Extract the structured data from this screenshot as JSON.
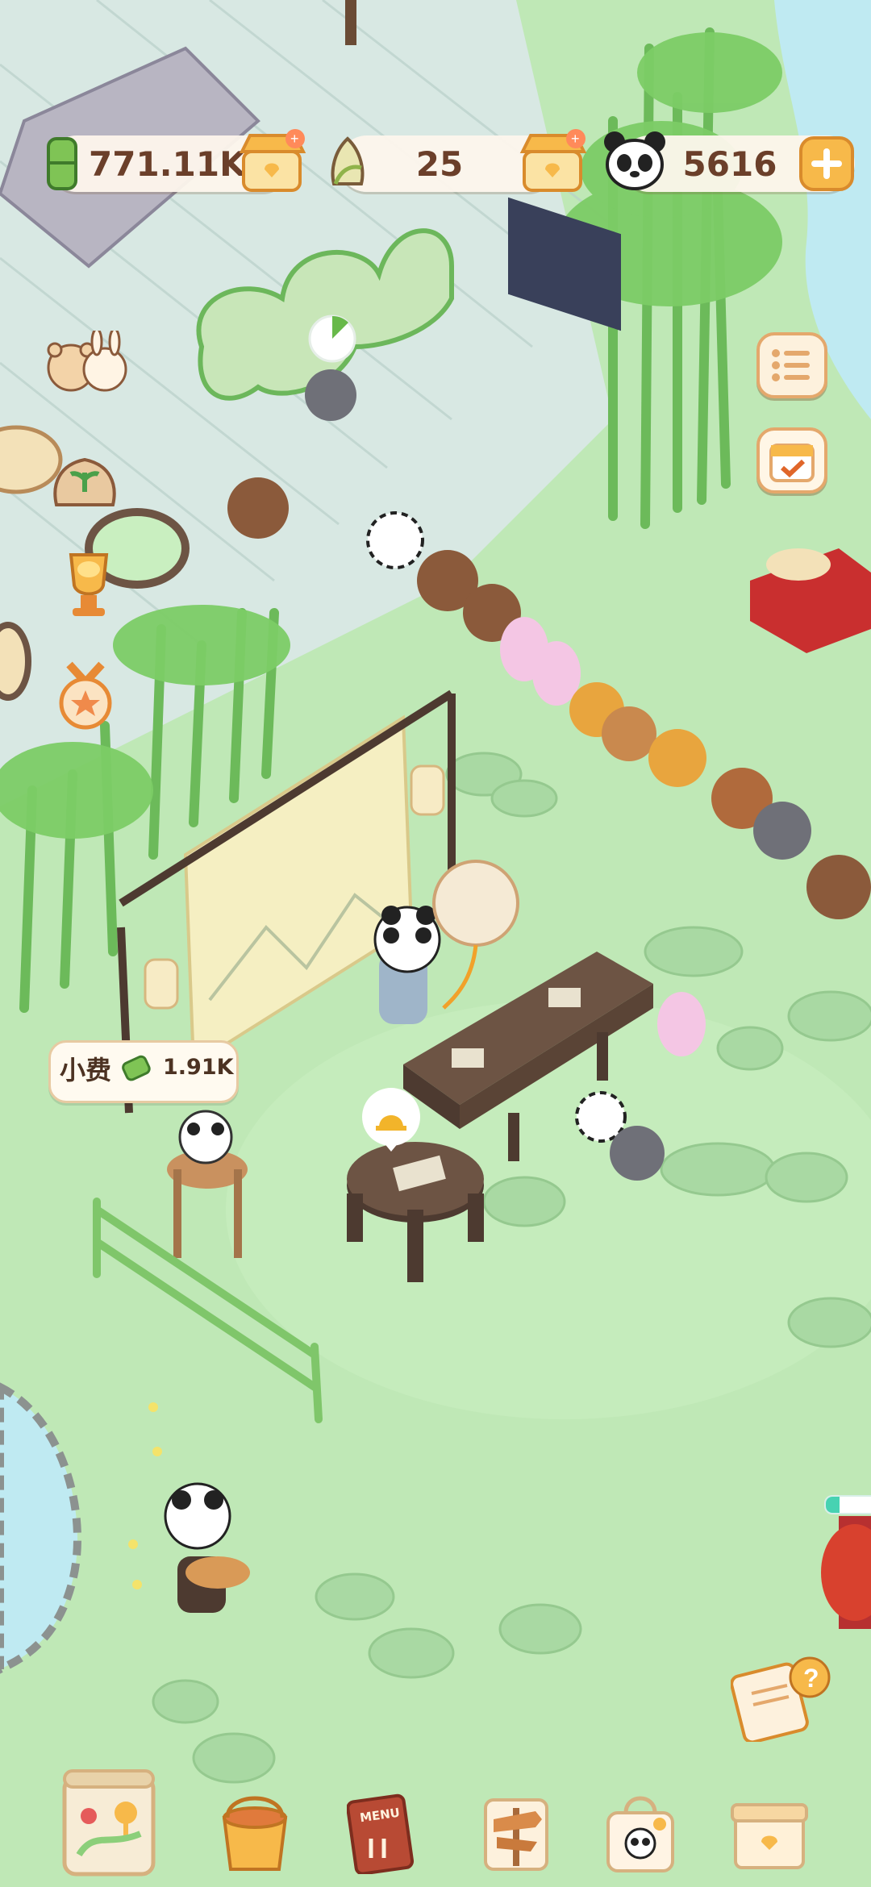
{
  "resources": {
    "bamboo": "771.11K",
    "shoots": "25",
    "pandas": "5616"
  },
  "tip": {
    "label": "小费",
    "value": "1.91K"
  },
  "icons": {
    "bamboo_currency": "bamboo-stalk-icon",
    "bamboo_shoot": "bamboo-shoot-icon",
    "panda": "panda-face-icon",
    "shop": "shop-stall-icon",
    "add": "plus-icon",
    "menu": "list-menu-icon",
    "calendar": "calendar-check-icon",
    "bell": "bell-icon",
    "quest": "question-note-icon",
    "map": "map-icon",
    "paint": "paint-bucket-icon",
    "recipe_menu": "menu-book-icon",
    "sign": "signpost-icon",
    "bag": "panda-bag-icon",
    "box": "storage-box-icon",
    "medal": "medal-icon",
    "trophy": "trophy-icon",
    "seedling": "seedling-bag-icon",
    "friends": "bear-bunny-icon"
  },
  "bottom_menu": {
    "menu_book_text": "MENU"
  },
  "progress": {
    "event_bar_fraction": 0.3
  },
  "colors": {
    "grass": "#bfe8b6",
    "stone": "#d4e6e2",
    "accent": "#e4a86c",
    "text": "#6b3f2a",
    "pond": "#bfeaf2"
  }
}
